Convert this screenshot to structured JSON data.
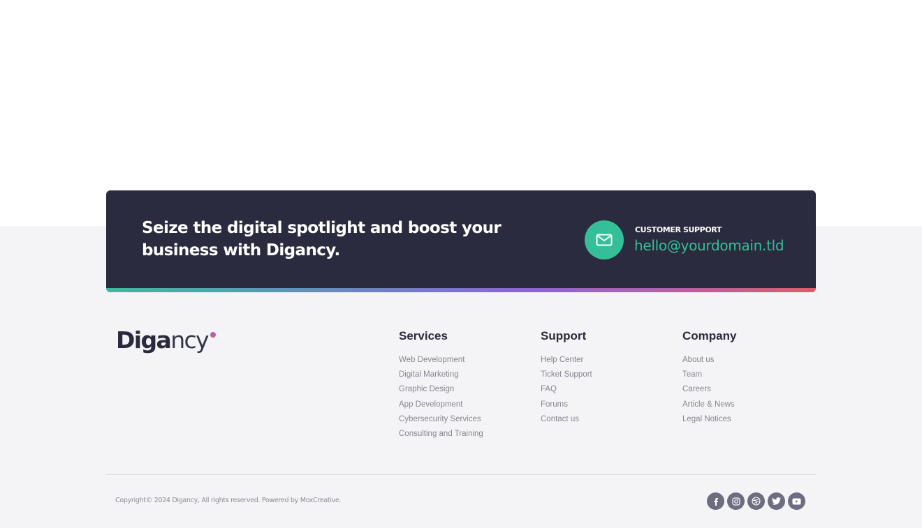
{
  "cta": {
    "headline": "Seize the digital spotlight and boost your business with Digancy.",
    "support_label": "CUSTOMER SUPPORT",
    "support_email": "hello@yourdomain.tld",
    "icon": "envelope-icon",
    "accent_color": "#35bf98",
    "gradient_colors": [
      "#3bbc9e",
      "#6a86c2",
      "#8d65cf",
      "#b461a8",
      "#e05a68"
    ]
  },
  "logo": {
    "bold_part": "Diga",
    "light_part": "ncy"
  },
  "columns": [
    {
      "title": "Services",
      "links": [
        "Web Development",
        "Digital Marketing",
        "Graphic Design",
        "App Development",
        "Cybersecurity Services",
        "Consulting and Training"
      ]
    },
    {
      "title": "Support",
      "links": [
        "Help Center",
        "Ticket Support",
        "FAQ",
        "Forums",
        "Contact us"
      ]
    },
    {
      "title": "Company",
      "links": [
        "About us",
        "Team",
        "Careers",
        "Article & News",
        "Legal Notices"
      ]
    }
  ],
  "bottom": {
    "copyright": "Copyright© 2024 Digancy, All rights reserved. Powered by MoxCreative.",
    "socials": [
      {
        "name": "facebook",
        "icon": "facebook-icon"
      },
      {
        "name": "instagram",
        "icon": "instagram-icon"
      },
      {
        "name": "dribbble",
        "icon": "dribbble-icon"
      },
      {
        "name": "twitter",
        "icon": "twitter-icon"
      },
      {
        "name": "youtube",
        "icon": "youtube-icon"
      }
    ]
  }
}
